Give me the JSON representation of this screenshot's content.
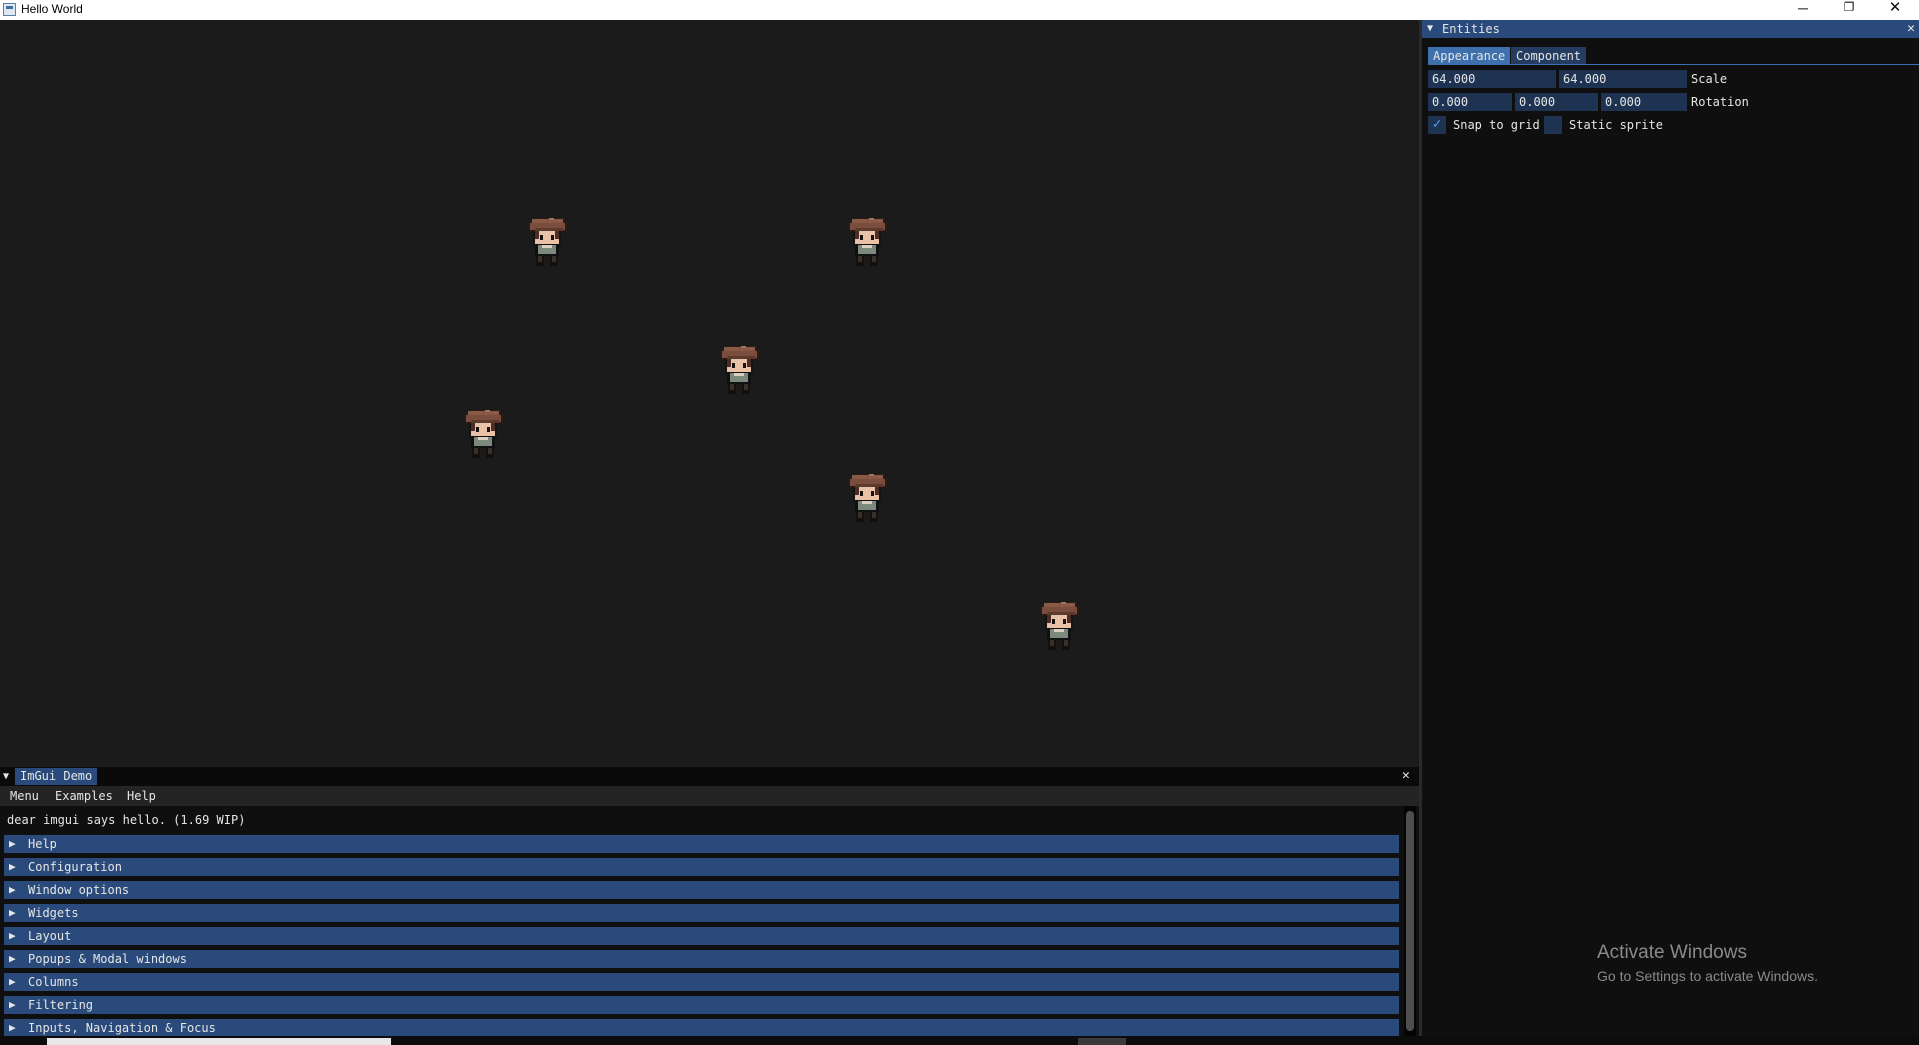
{
  "window": {
    "title": "Hello World",
    "minimize_glyph": "─",
    "maximize_glyph": "❐",
    "close_glyph": "✕"
  },
  "viewport": {
    "sprites": [
      {
        "name": "character"
      },
      {
        "name": "character"
      },
      {
        "name": "character"
      },
      {
        "name": "character"
      },
      {
        "name": "character"
      },
      {
        "name": "character"
      }
    ]
  },
  "entities_panel": {
    "title": "Entities",
    "collapse_glyph": "▼",
    "close_glyph": "✕",
    "tabs": [
      {
        "label": "Appearance",
        "active": true
      },
      {
        "label": "Component",
        "active": false
      }
    ],
    "scale": {
      "values": [
        "64.000",
        "64.000"
      ],
      "label": "Scale"
    },
    "rotation": {
      "values": [
        "0.000",
        "0.000",
        "0.000"
      ],
      "label": "Rotation"
    },
    "snap_to_grid": {
      "label": "Snap to grid",
      "checked": true,
      "check_glyph": "✓"
    },
    "static_sprite": {
      "label": "Static sprite",
      "checked": false
    }
  },
  "activation_notice": {
    "title": "Activate Windows",
    "subtitle": "Go to Settings to activate Windows."
  },
  "imgui_demo": {
    "title": "ImGui Demo",
    "collapse_glyph": "▼",
    "close_glyph": "✕",
    "menu": [
      "Menu",
      "Examples",
      "Help"
    ],
    "hello_text": "dear imgui says hello. (1.69 WIP)",
    "headers": [
      "Help",
      "Configuration",
      "Window options",
      "Widgets",
      "Layout",
      "Popups & Modal windows",
      "Columns",
      "Filtering",
      "Inputs, Navigation & Focus"
    ],
    "header_arrow": "▶"
  },
  "colors": {
    "accent": "#294a7a",
    "active_tab": "#3d70ad",
    "field_bg": "#1e3352",
    "background": "#1b1b1b"
  }
}
